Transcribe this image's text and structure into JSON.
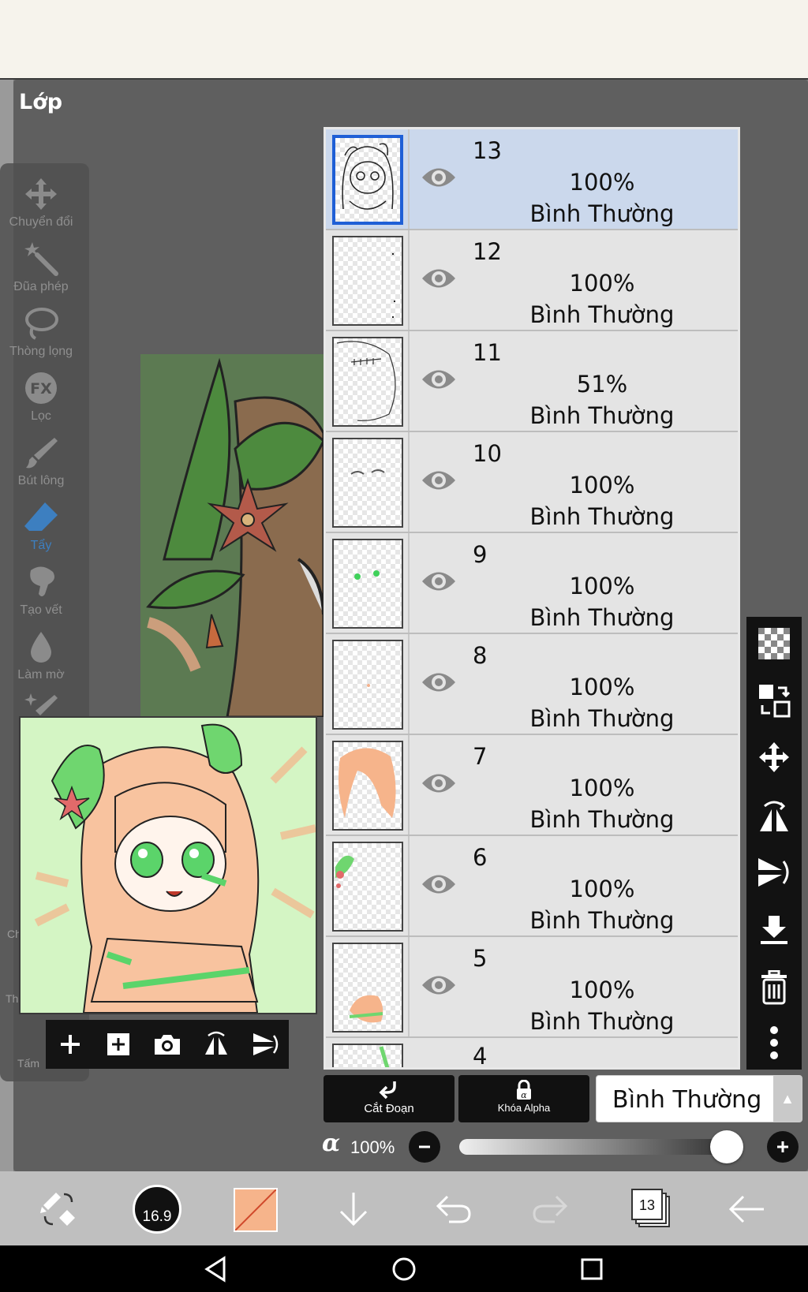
{
  "panel": {
    "title": "Lớp"
  },
  "tools": [
    {
      "label": "Chuyển đổi",
      "icon": "move-icon"
    },
    {
      "label": "Đũa phép",
      "icon": "magic-wand-icon"
    },
    {
      "label": "Thòng lọng",
      "icon": "lasso-icon"
    },
    {
      "label": "Lọc",
      "icon": "fx-filter-icon",
      "icon_text": "FX"
    },
    {
      "label": "Bút lông",
      "icon": "brush-icon"
    },
    {
      "label": "Tẩy",
      "icon": "eraser-icon",
      "active": true
    },
    {
      "label": "Tạo vết",
      "icon": "smudge-icon"
    },
    {
      "label": "Làm mờ",
      "icon": "blur-icon"
    },
    {
      "label": "",
      "icon": "sparkle-brush-icon"
    }
  ],
  "side_fragments": {
    "frag1": "Ch",
    "frag2": "Th",
    "frag3": "Tấm"
  },
  "layers": [
    {
      "number": "13",
      "opacity": "100%",
      "mode": "Bình Thường",
      "selected": true
    },
    {
      "number": "12",
      "opacity": "100%",
      "mode": "Bình Thường"
    },
    {
      "number": "11",
      "opacity": "51%",
      "mode": "Bình Thường"
    },
    {
      "number": "10",
      "opacity": "100%",
      "mode": "Bình Thường"
    },
    {
      "number": "9",
      "opacity": "100%",
      "mode": "Bình Thường"
    },
    {
      "number": "8",
      "opacity": "100%",
      "mode": "Bình Thường"
    },
    {
      "number": "7",
      "opacity": "100%",
      "mode": "Bình Thường"
    },
    {
      "number": "6",
      "opacity": "100%",
      "mode": "Bình Thường"
    },
    {
      "number": "5",
      "opacity": "100%",
      "mode": "Bình Thường"
    },
    {
      "number": "4"
    }
  ],
  "layer_actions": {
    "clip_label": "Cắt Đoạn",
    "alpha_lock_label": "Khóa Alpha",
    "blend_mode": "Bình Thường"
  },
  "alpha": {
    "symbol": "α",
    "value": "100%",
    "level": 1.0
  },
  "bottom_toolbar": {
    "brush_size": "16.9",
    "layer_count": "13",
    "color": "#f6b48b"
  }
}
